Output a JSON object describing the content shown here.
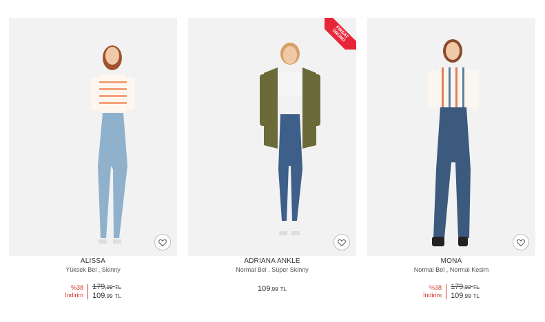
{
  "products": [
    {
      "name": "ALISSA",
      "subtitle": "Yüksek Bel , Skinny",
      "discount_pct": "%38",
      "discount_label": "İndirim",
      "old_int": "179",
      "old_dec": ",99",
      "old_cur": "TL",
      "new_int": "109",
      "new_dec": ",99",
      "new_cur": "TL",
      "palette": {
        "top": "#f6a07a",
        "jeans": "#8fb1cc"
      }
    },
    {
      "name": "ADRIANA ANKLE",
      "subtitle": "Normal Bel , Süper Skinny",
      "badge_line1": "FIRSAT",
      "badge_line2": "ÜRÜNÜ",
      "new_int": "109",
      "new_dec": ",99",
      "new_cur": "TL",
      "palette": {
        "jacket": "#6b6a39",
        "jeans": "#3d5f8a"
      }
    },
    {
      "name": "MONA",
      "subtitle": "Normal Bel , Normal Kesim",
      "discount_pct": "%38",
      "discount_label": "İndirim",
      "old_int": "179",
      "old_dec": ",99",
      "old_cur": "TL",
      "new_int": "109",
      "new_dec": ",99",
      "new_cur": "TL",
      "palette": {
        "shirt": "#e07f5c",
        "jeans": "#3b5a7d"
      }
    }
  ],
  "colors": {
    "discount": "#d9342b",
    "badge": "#e8263a"
  }
}
